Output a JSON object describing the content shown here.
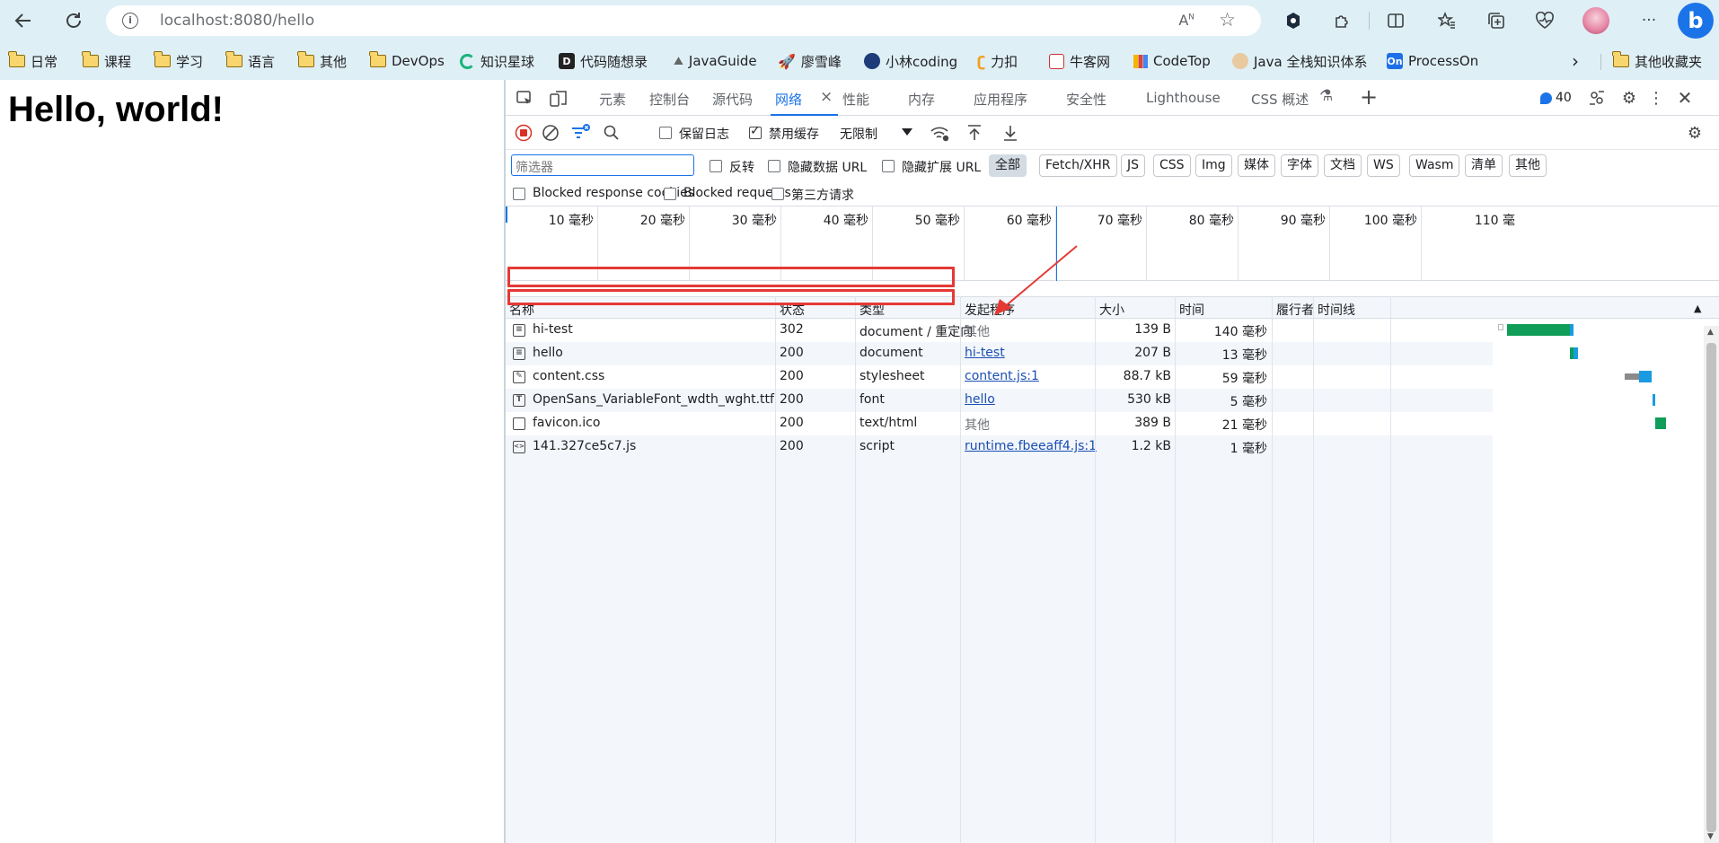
{
  "browser": {
    "url_host": "localhost",
    "url_path": ":8080/hello",
    "read_aloud": "A",
    "read_aloud_sup": "N",
    "avatar": "",
    "bing_label": "b"
  },
  "bookmarks": [
    {
      "label": "日常",
      "icon": "folder-icon"
    },
    {
      "label": "课程",
      "icon": "folder-icon"
    },
    {
      "label": "学习",
      "icon": "folder-icon"
    },
    {
      "label": "语言",
      "icon": "folder-icon"
    },
    {
      "label": "其他",
      "icon": "folder-icon"
    },
    {
      "label": "DevOps",
      "icon": "folder-icon"
    },
    {
      "label": "知识星球",
      "icon": "planet-icon"
    },
    {
      "label": "代码随想录",
      "icon": "code-icon"
    },
    {
      "label": "JavaGuide",
      "icon": "guide-icon"
    },
    {
      "label": "廖雪峰",
      "icon": "rocket-icon"
    },
    {
      "label": "小林coding",
      "icon": "xiaolin-icon"
    },
    {
      "label": "力扣",
      "icon": "leetcode-icon"
    },
    {
      "label": "牛客网",
      "icon": "nowcoder-icon"
    },
    {
      "label": "CodeTop",
      "icon": "chart-icon"
    },
    {
      "label": "Java 全栈知识体系",
      "icon": "java-icon"
    },
    {
      "label": "ProcessOn",
      "icon": "processon-icon"
    }
  ],
  "bookmark_icon_text": {
    "code": "D",
    "processon": "On"
  },
  "bookmarks_more": "›",
  "other_bookmarks": "其他收藏夹",
  "page": {
    "heading": "Hello, world!"
  },
  "devtools": {
    "tabs": [
      "元素",
      "控制台",
      "源代码",
      "网络",
      "性能",
      "内存",
      "应用程序",
      "安全性",
      "Lighthouse",
      "CSS 概述"
    ],
    "active_tab": "网络",
    "tab_close": "×",
    "issues_count": "40",
    "toolbar": {
      "preserve_log": "保留日志",
      "disable_cache": "禁用缓存",
      "throttle": "无限制"
    },
    "filter": {
      "placeholder": "筛选器",
      "invert": "反转",
      "hide_data_url": "隐藏数据 URL",
      "hide_ext_url": "隐藏扩展 URL",
      "types": [
        "全部",
        "Fetch/XHR",
        "JS",
        "CSS",
        "Img",
        "媒体",
        "字体",
        "文档",
        "WS",
        "Wasm",
        "清单",
        "其他"
      ],
      "selected_type": "全部"
    },
    "options": {
      "blocked_cookies": "Blocked response cookies",
      "blocked_requests": "Blocked requests",
      "third_party": "第三方请求"
    },
    "overview_ticks": [
      "10 毫秒",
      "20 毫秒",
      "30 毫秒",
      "40 毫秒",
      "50 毫秒",
      "60 毫秒",
      "70 毫秒",
      "80 毫秒",
      "90 毫秒",
      "100 毫秒",
      "110 毫"
    ],
    "columns": {
      "name": "名称",
      "status": "状态",
      "type": "类型",
      "initiator": "发起程序",
      "size": "大小",
      "time": "时间",
      "fulfilled_by": "履行者",
      "waterfall": "时间线"
    },
    "rows": [
      {
        "name": "hi-test",
        "icon": "document-icon",
        "status": "302",
        "type": "document / 重定向",
        "initiator": "其他",
        "initiator_link": false,
        "size": "139 B",
        "time": "140 毫秒",
        "highlighted": true
      },
      {
        "name": "hello",
        "icon": "document-icon",
        "status": "200",
        "type": "document",
        "initiator": "hi-test",
        "initiator_link": true,
        "size": "207 B",
        "time": "13 毫秒",
        "highlighted": true
      },
      {
        "name": "content.css",
        "icon": "stylesheet-icon",
        "status": "200",
        "type": "stylesheet",
        "initiator": "content.js:1",
        "initiator_link": true,
        "size": "88.7 kB",
        "time": "59 毫秒",
        "highlighted": false
      },
      {
        "name": "OpenSans_VariableFont_wdth_wght.ttf",
        "icon": "font-icon",
        "status": "200",
        "type": "font",
        "initiator": "hello",
        "initiator_link": true,
        "size": "530 kB",
        "time": "5 毫秒",
        "highlighted": false
      },
      {
        "name": "favicon.ico",
        "icon": "image-icon",
        "status": "200",
        "type": "text/html",
        "initiator": "其他",
        "initiator_link": false,
        "size": "389 B",
        "time": "21 毫秒",
        "highlighted": false
      },
      {
        "name": "141.327ce5c7.js",
        "icon": "script-icon",
        "status": "200",
        "type": "script",
        "initiator": "runtime.fbeeaff4.js:1",
        "initiator_link": true,
        "size": "1.2 kB",
        "time": "1 毫秒",
        "highlighted": false
      }
    ],
    "colors": {
      "accent": "#1a73e8",
      "highlight": "#e53935",
      "waiting": "#0f9d58",
      "download": "#1a9ae0",
      "queued": "#8a8a8a"
    }
  }
}
